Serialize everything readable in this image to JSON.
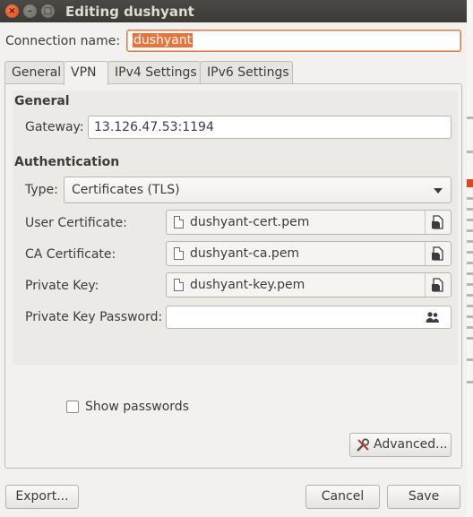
{
  "window": {
    "title": "Editing dushyant",
    "controls": {
      "close": "×",
      "minimize": "–",
      "maximize": "□"
    }
  },
  "connection": {
    "label": "Connection name:",
    "value": "dushyant"
  },
  "tabs": [
    {
      "label": "General",
      "active": false
    },
    {
      "label": "VPN",
      "active": true
    },
    {
      "label": "IPv4 Settings",
      "active": false
    },
    {
      "label": "IPv6 Settings",
      "active": false
    }
  ],
  "general": {
    "heading": "General",
    "gateway_label": "Gateway:",
    "gateway_value": "13.126.47.53:1194"
  },
  "authentication": {
    "heading": "Authentication",
    "type_label": "Type:",
    "type_value": "Certificates (TLS)",
    "user_cert_label": "User Certificate:",
    "user_cert_value": "dushyant-cert.pem",
    "ca_cert_label": "CA Certificate:",
    "ca_cert_value": "dushyant-ca.pem",
    "private_key_label": "Private Key:",
    "private_key_value": "dushyant-key.pem",
    "private_key_password_label": "Private Key Password:",
    "private_key_password_value": ""
  },
  "options": {
    "show_passwords_label": "Show passwords",
    "show_passwords_checked": false,
    "advanced_label": "Advanced..."
  },
  "footer": {
    "export_label": "Export...",
    "cancel_label": "Cancel",
    "save_label": "Save"
  },
  "colors": {
    "accent": "#dd4814",
    "titlebar": "#3c3b37",
    "selection": "#e9733c"
  },
  "icons": {
    "file": "document-icon",
    "open": "open-file-icon",
    "password_storage": "users-icon",
    "advanced": "tools-icon"
  }
}
